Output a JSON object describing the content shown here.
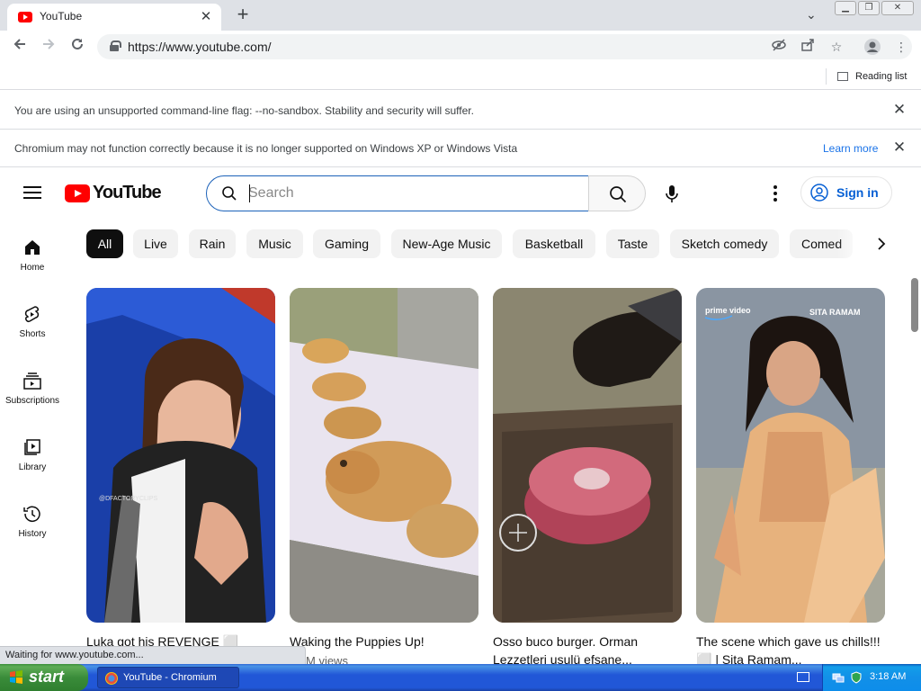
{
  "browser": {
    "tab_title": "YouTube",
    "url": "https://www.youtube.com/",
    "reading_list_label": "Reading list",
    "infobars": [
      {
        "message": "You are using an unsupported command-line flag: --no-sandbox. Stability and security will suffer."
      },
      {
        "message": "Chromium may not function correctly because it is no longer supported on Windows XP or Windows Vista",
        "link": "Learn more"
      }
    ],
    "status_text": "Waiting for www.youtube.com..."
  },
  "youtube": {
    "logo_text": "YouTube",
    "search_placeholder": "Search",
    "signin_label": "Sign in",
    "sidenav": [
      {
        "label": "Home",
        "icon": "home-icon"
      },
      {
        "label": "Shorts",
        "icon": "shorts-icon"
      },
      {
        "label": "Subscriptions",
        "icon": "subscriptions-icon"
      },
      {
        "label": "Library",
        "icon": "library-icon"
      },
      {
        "label": "History",
        "icon": "history-icon"
      }
    ],
    "chips": [
      "All",
      "Live",
      "Rain",
      "Music",
      "Gaming",
      "New-Age Music",
      "Basketball",
      "Taste",
      "Sketch comedy",
      "Comed"
    ],
    "videos": [
      {
        "title": "Luka got his REVENGE ⬜",
        "meta": "",
        "watermark": "@DFACTORYCLIPS"
      },
      {
        "title": "Waking the Puppies Up!",
        "meta": "M views"
      },
      {
        "title": "Osso buco burger. Orman Lezzetleri usulü efsane...",
        "meta": ""
      },
      {
        "title": "The scene which gave us chills!!!⬜ | Sita Ramam...",
        "meta": "",
        "brand": "prime video",
        "overlay": "SITA RAMAM"
      }
    ],
    "colors": {
      "brand_red": "#ff0000",
      "link_blue": "#065fd4",
      "chip_bg": "#f2f2f2"
    }
  },
  "taskbar": {
    "start_label": "start",
    "item_label": "YouTube - Chromium",
    "clock": "3:18 AM"
  }
}
